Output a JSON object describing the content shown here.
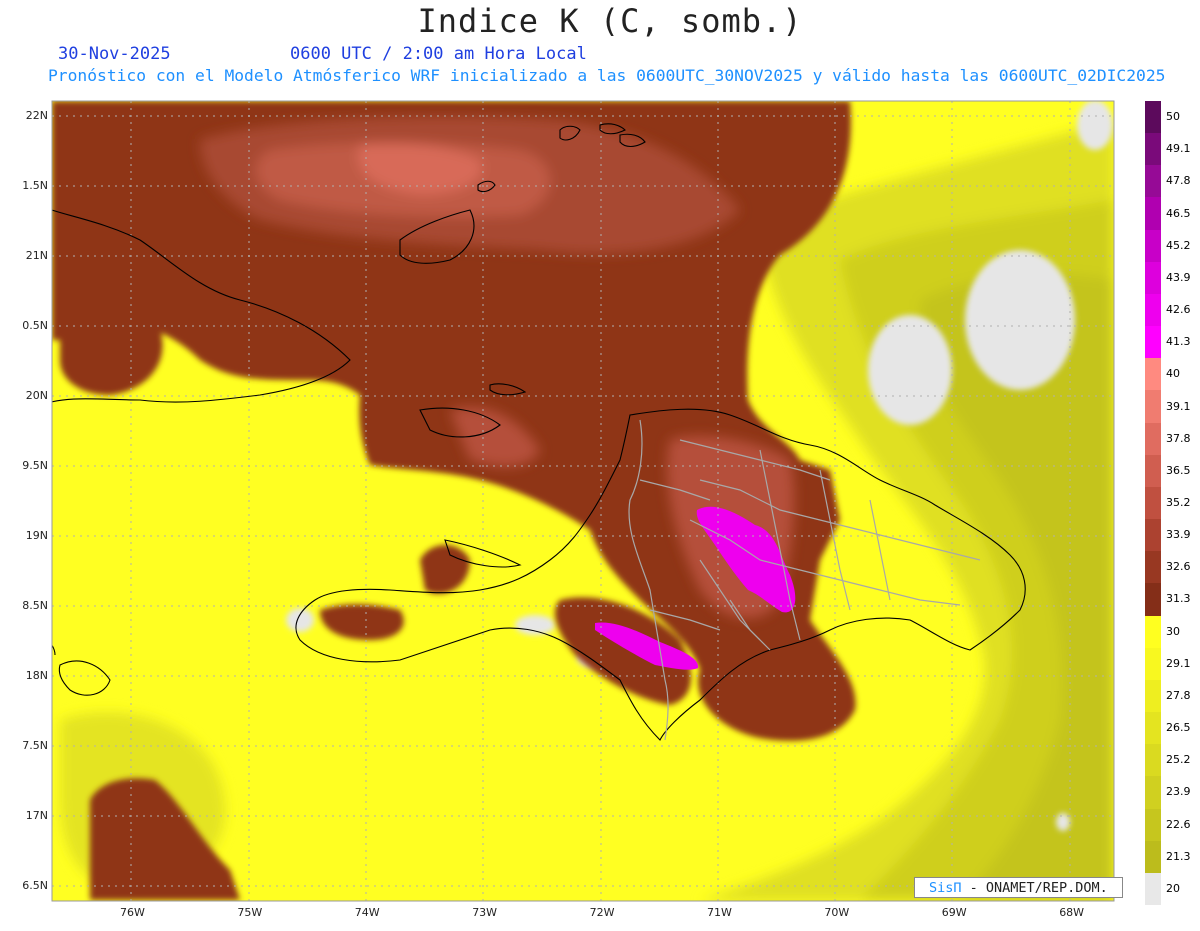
{
  "header": {
    "title": "Indice K (C, somb.)",
    "date": "30-Nov-2025",
    "time": "0600 UTC / 2:00 am Hora Local",
    "subtitle": "Pronóstico con el Modelo Atmósferico WRF inicializado a las 0600UTC_30NOV2025 y válido hasta las  0600UTC_02DIC2025"
  },
  "credit": {
    "logo": "SisΠ",
    "text": " - ONAMET/REP.DOM."
  },
  "axes": {
    "lat_labels": [
      "22N",
      "1.5N",
      "21N",
      "0.5N",
      "20N",
      "9.5N",
      "19N",
      "8.5N",
      "18N",
      "7.5N",
      "17N",
      "6.5N"
    ],
    "lon_labels": [
      "76W",
      "75W",
      "74W",
      "73W",
      "72W",
      "71W",
      "70W",
      "69W",
      "68W"
    ]
  },
  "colorbar": {
    "labels": [
      "50",
      "49.1",
      "47.8",
      "46.5",
      "45.2",
      "43.9",
      "42.6",
      "41.3",
      "40",
      "39.1",
      "37.8",
      "36.5",
      "35.2",
      "33.9",
      "32.6",
      "31.3",
      "30",
      "29.1",
      "27.8",
      "26.5",
      "25.2",
      "23.9",
      "22.6",
      "21.3",
      "20"
    ],
    "colors": [
      "#5c0a5c",
      "#7a0a7a",
      "#960a96",
      "#b000b0",
      "#c800c8",
      "#dd00dd",
      "#ee00ee",
      "#ff00ff",
      "#ff8a80",
      "#f07c70",
      "#e06c60",
      "#d05e50",
      "#c05040",
      "#ac4230",
      "#983822",
      "#842e18",
      "#ffff20",
      "#f8f820",
      "#eeee20",
      "#e4e420",
      "#dada20",
      "#d0d020",
      "#c6c61e",
      "#bcbc1c",
      "#e8e8e8"
    ]
  },
  "colors": {
    "base": "#ffff22",
    "low": "#c4c41e",
    "brown": "#8b3318",
    "brown_light": "#b5503a",
    "salmon": "#e0665a",
    "magenta": "#ee00ee",
    "grey": "#e6e6e6",
    "coast": "#000000",
    "border": "#a8a8a8"
  }
}
